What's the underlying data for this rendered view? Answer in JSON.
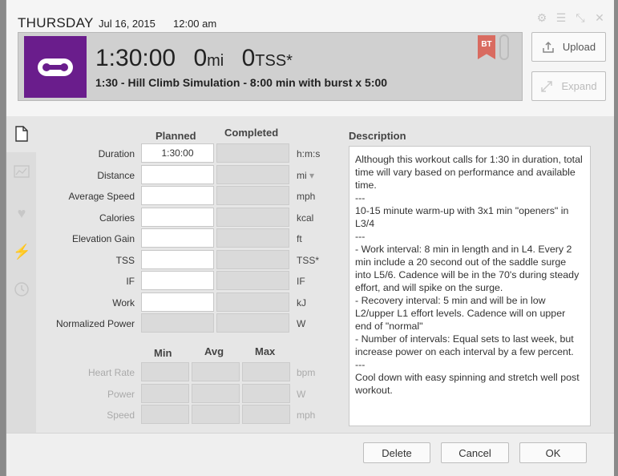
{
  "header": {
    "day": "THURSDAY",
    "date": "Jul 16, 2015",
    "time": "12:00 am"
  },
  "summary": {
    "duration": "1:30:00",
    "distance_value": "0",
    "distance_unit": "mi",
    "tss_value": "0",
    "tss_unit": "TSS*",
    "title": "1:30 - Hill Climb Simulation - 8:00 min with burst x 5:00",
    "badge": "BT"
  },
  "buttons": {
    "upload": "Upload",
    "expand": "Expand",
    "delete": "Delete",
    "cancel": "Cancel",
    "ok": "OK"
  },
  "columns": {
    "planned": "Planned",
    "completed": "Completed",
    "min": "Min",
    "avg": "Avg",
    "max": "Max",
    "description": "Description"
  },
  "rows": [
    {
      "label": "Duration",
      "planned": "1:30:00",
      "unit": "h:m:s"
    },
    {
      "label": "Distance",
      "planned": "",
      "unit": "mi"
    },
    {
      "label": "Average Speed",
      "planned": "",
      "unit": "mph"
    },
    {
      "label": "Calories",
      "planned": "",
      "unit": "kcal"
    },
    {
      "label": "Elevation Gain",
      "planned": "",
      "unit": "ft"
    },
    {
      "label": "TSS",
      "planned": "",
      "unit": "TSS*"
    },
    {
      "label": "IF",
      "planned": "",
      "unit": "IF"
    },
    {
      "label": "Work",
      "planned": "",
      "unit": "kJ"
    },
    {
      "label": "Normalized Power",
      "planned": "",
      "unit": "W"
    }
  ],
  "range_rows": [
    {
      "label": "Heart Rate",
      "unit": "bpm"
    },
    {
      "label": "Power",
      "unit": "W"
    },
    {
      "label": "Speed",
      "unit": "mph"
    }
  ],
  "description": "Although this workout calls for 1:30 in duration, total time will vary based on performance and available time.\n---\n10-15 minute warm-up with 3x1 min \"openers\" in L3/4\n---\n- Work interval: 8 min in length and in L4. Every 2 min include a 20 second out of the saddle surge into L5/6. Cadence will be in the 70's during steady effort, and will spike on the surge.\n- Recovery interval: 5 min and will be in low L2/upper L1 effort levels. Cadence will on upper end of \"normal\"\n- Number of intervals: Equal sets to last week, but increase power on each interval by a few percent.\n---\nCool down with easy spinning and stretch well post workout.",
  "colors": {
    "sport_icon_bg": "#6a1d8c",
    "badge_bg": "#d96b60"
  }
}
